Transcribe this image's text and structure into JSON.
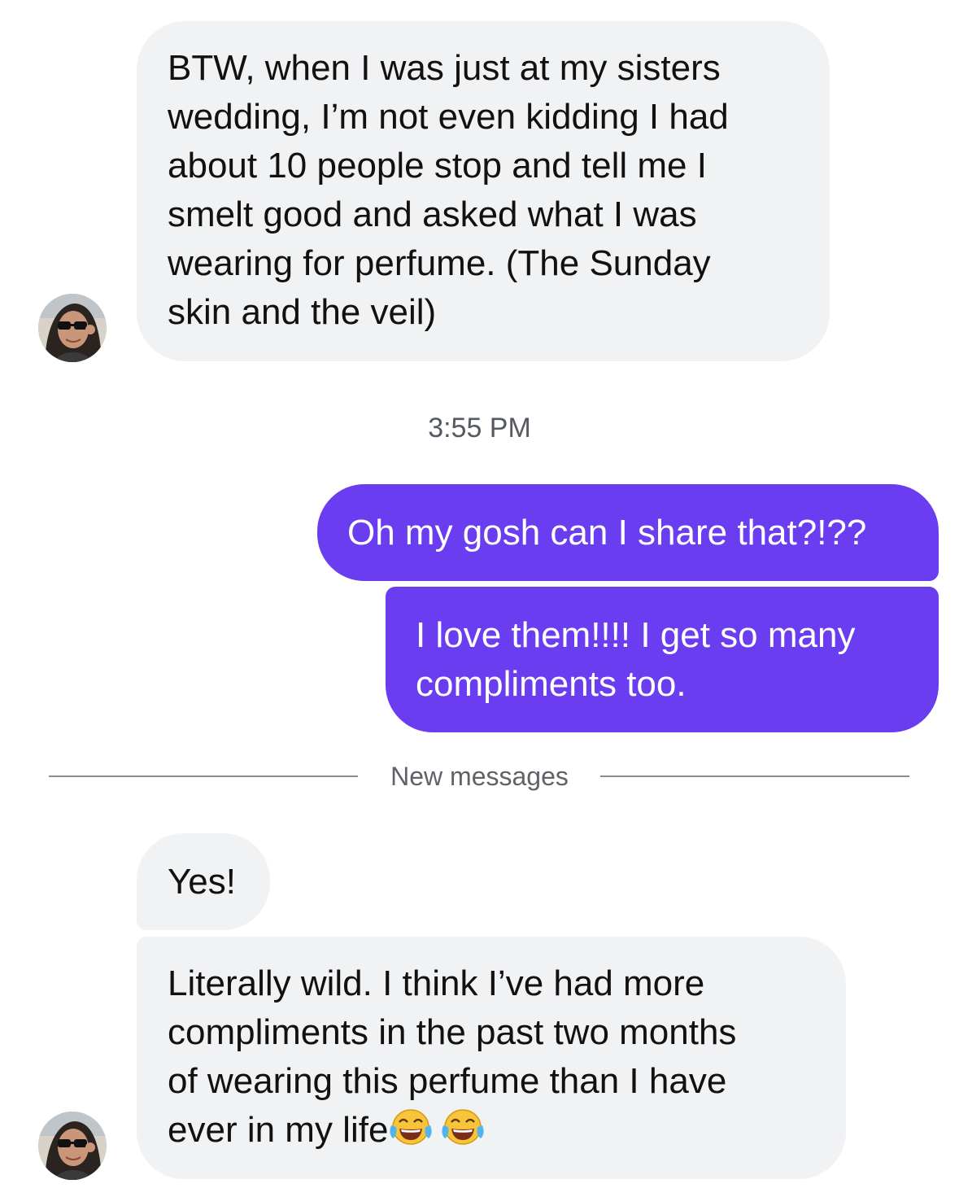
{
  "conversation": {
    "messages": [
      {
        "direction": "incoming",
        "lines": [
          "BTW, when I was just at my sisters",
          "wedding, I’m not even kidding I had",
          "about 10 people stop and tell me I",
          "smelt good and asked what I was",
          "wearing for perfume. (The Sunday",
          "skin and the veil)"
        ]
      },
      {
        "direction": "outgoing",
        "lines": [
          "Oh my gosh can I share that?!??"
        ]
      },
      {
        "direction": "outgoing",
        "lines": [
          "I love them!!!! I get so many",
          "compliments too."
        ]
      },
      {
        "direction": "incoming",
        "lines": [
          "Yes!"
        ]
      },
      {
        "direction": "incoming",
        "lines": [
          "Literally wild. I think I’ve had more",
          "compliments in the past two months",
          "of wearing this perfume than I have",
          "ever in my life"
        ],
        "trailing_emoji": [
          "face-with-tears-of-joy-icon",
          "face-with-tears-of-joy-icon"
        ]
      }
    ],
    "timestamp": "3:55 PM",
    "new_messages_divider": "New messages"
  },
  "colors": {
    "outgoing_bubble": "#6a3ef0",
    "incoming_bubble": "#f1f2f4",
    "divider": "#8a8e93"
  }
}
